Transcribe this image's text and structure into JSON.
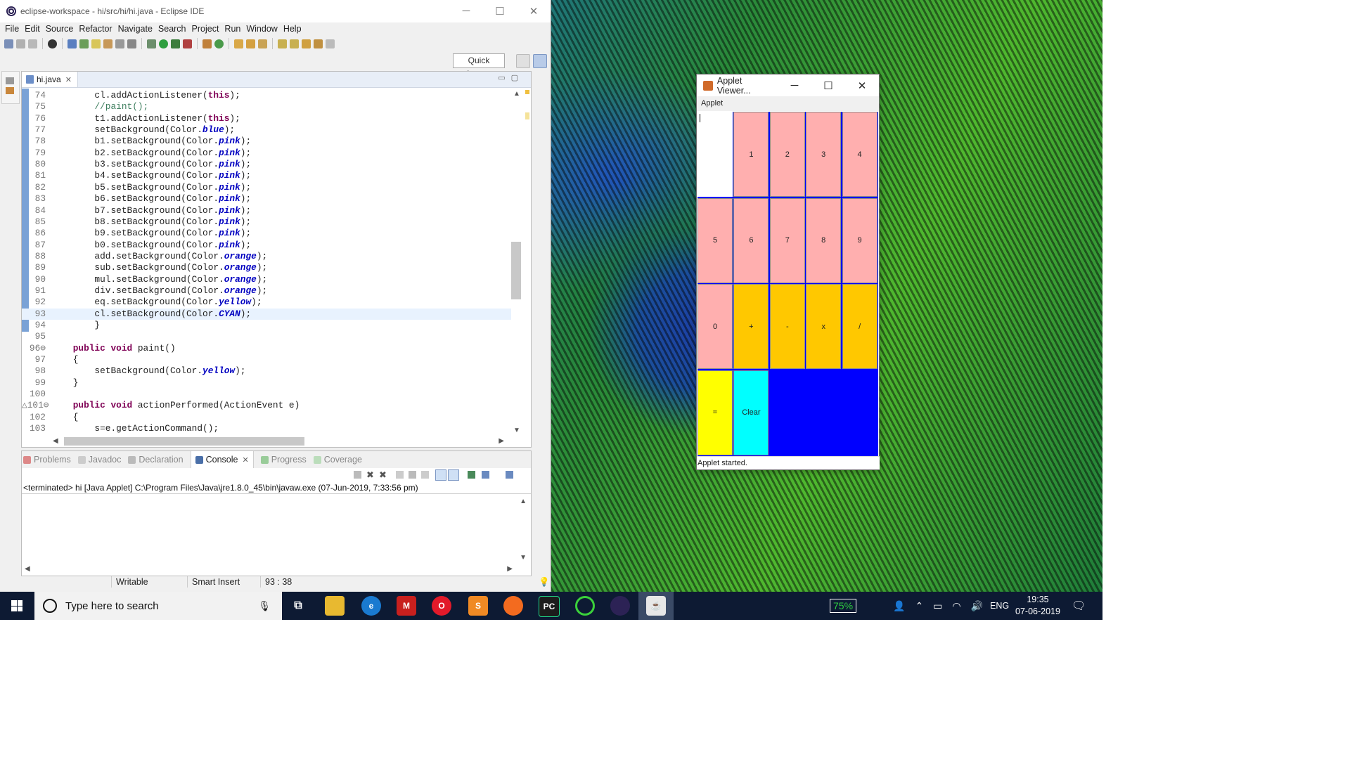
{
  "eclipse": {
    "title": "eclipse-workspace - hi/src/hi/hi.java - Eclipse IDE",
    "menu": [
      "File",
      "Edit",
      "Source",
      "Refactor",
      "Navigate",
      "Search",
      "Project",
      "Run",
      "Window",
      "Help"
    ],
    "quick_access": "Quick Access",
    "editor_tab": "hi.java",
    "code_lines": [
      {
        "n": "74",
        "html": "        cl.addActionListener(<span class=\"kw\">this</span>);"
      },
      {
        "n": "75",
        "html": "        <span class=\"cm\">//paint();</span>"
      },
      {
        "n": "76",
        "html": "        t1.addActionListener(<span class=\"kw\">this</span>);"
      },
      {
        "n": "77",
        "html": "        setBackground(Color.<span class=\"fld\">blue</span>);"
      },
      {
        "n": "78",
        "html": "        b1.setBackground(Color.<span class=\"fld\">pink</span>);"
      },
      {
        "n": "79",
        "html": "        b2.setBackground(Color.<span class=\"fld\">pink</span>);"
      },
      {
        "n": "80",
        "html": "        b3.setBackground(Color.<span class=\"fld\">pink</span>);"
      },
      {
        "n": "81",
        "html": "        b4.setBackground(Color.<span class=\"fld\">pink</span>);"
      },
      {
        "n": "82",
        "html": "        b5.setBackground(Color.<span class=\"fld\">pink</span>);"
      },
      {
        "n": "83",
        "html": "        b6.setBackground(Color.<span class=\"fld\">pink</span>);"
      },
      {
        "n": "84",
        "html": "        b7.setBackground(Color.<span class=\"fld\">pink</span>);"
      },
      {
        "n": "85",
        "html": "        b8.setBackground(Color.<span class=\"fld\">pink</span>);"
      },
      {
        "n": "86",
        "html": "        b9.setBackground(Color.<span class=\"fld\">pink</span>);"
      },
      {
        "n": "87",
        "html": "        b0.setBackground(Color.<span class=\"fld\">pink</span>);"
      },
      {
        "n": "88",
        "html": "        add.setBackground(Color.<span class=\"fld\">orange</span>);"
      },
      {
        "n": "89",
        "html": "        sub.setBackground(Color.<span class=\"fld\">orange</span>);"
      },
      {
        "n": "90",
        "html": "        mul.setBackground(Color.<span class=\"fld\">orange</span>);"
      },
      {
        "n": "91",
        "html": "        div.setBackground(Color.<span class=\"fld\">orange</span>);"
      },
      {
        "n": "92",
        "html": "        eq.setBackground(Color.<span class=\"fld\">yellow</span>);"
      },
      {
        "n": "93",
        "html": "        cl.setBackground(Color.<span class=\"fld\">CYAN</span>);",
        "current": true
      },
      {
        "n": "94",
        "html": "        }"
      },
      {
        "n": "95",
        "html": ""
      },
      {
        "n": "96⊖",
        "html": "    <span class=\"kw\">public</span> <span class=\"kw\">void</span> paint()"
      },
      {
        "n": "97",
        "html": "    {"
      },
      {
        "n": "98",
        "html": "        setBackground(Color.<span class=\"fld\">yellow</span>);"
      },
      {
        "n": "99",
        "html": "    }"
      },
      {
        "n": "100",
        "html": ""
      },
      {
        "n": "△101⊖",
        "html": "    <span class=\"kw\">public</span> <span class=\"kw\">void</span> actionPerformed(ActionEvent e)"
      },
      {
        "n": "102",
        "html": "    {"
      },
      {
        "n": "103",
        "html": "        s=e.getActionCommand();"
      }
    ],
    "console_tabs": [
      "Problems",
      "Javadoc",
      "Declaration",
      "Console",
      "Progress",
      "Coverage"
    ],
    "console_active": "Console",
    "console_text": "<terminated> hi [Java Applet] C:\\Program Files\\Java\\jre1.8.0_45\\bin\\javaw.exe (07-Jun-2019, 7:33:56 pm)",
    "status": {
      "writable": "Writable",
      "insert": "Smart Insert",
      "position": "93 : 38"
    }
  },
  "applet": {
    "title": "Applet Viewer...",
    "menu": "Applet",
    "status": "Applet started.",
    "colors": {
      "pink": "#ffafaf",
      "orange": "#ffc800",
      "yellow": "#ffff00",
      "cyan": "#00ffff",
      "blue": "#0000ff",
      "white": "#ffffff"
    },
    "buttons": [
      {
        "label": "",
        "color": "white",
        "row": 0,
        "col": 0
      },
      {
        "label": "1",
        "color": "pink",
        "row": 0,
        "col": 1
      },
      {
        "label": "2",
        "color": "pink",
        "row": 0,
        "col": 2
      },
      {
        "label": "3",
        "color": "pink",
        "row": 0,
        "col": 3
      },
      {
        "label": "4",
        "color": "pink",
        "row": 0,
        "col": 4
      },
      {
        "label": "5",
        "color": "pink",
        "row": 1,
        "col": 0
      },
      {
        "label": "6",
        "color": "pink",
        "row": 1,
        "col": 1
      },
      {
        "label": "7",
        "color": "pink",
        "row": 1,
        "col": 2
      },
      {
        "label": "8",
        "color": "pink",
        "row": 1,
        "col": 3
      },
      {
        "label": "9",
        "color": "pink",
        "row": 1,
        "col": 4
      },
      {
        "label": "0",
        "color": "pink",
        "row": 2,
        "col": 0
      },
      {
        "label": "+",
        "color": "orange",
        "row": 2,
        "col": 1
      },
      {
        "label": "-",
        "color": "orange",
        "row": 2,
        "col": 2
      },
      {
        "label": "x",
        "color": "orange",
        "row": 2,
        "col": 3
      },
      {
        "label": "/",
        "color": "orange",
        "row": 2,
        "col": 4
      },
      {
        "label": "=",
        "color": "yellow",
        "row": 3,
        "col": 0
      },
      {
        "label": "Clear",
        "color": "cyan",
        "row": 3,
        "col": 1
      }
    ]
  },
  "taskbar": {
    "search_placeholder": "Type here to search",
    "battery": "75%",
    "language": "ENG",
    "time": "19:35",
    "date": "07-06-2019"
  }
}
